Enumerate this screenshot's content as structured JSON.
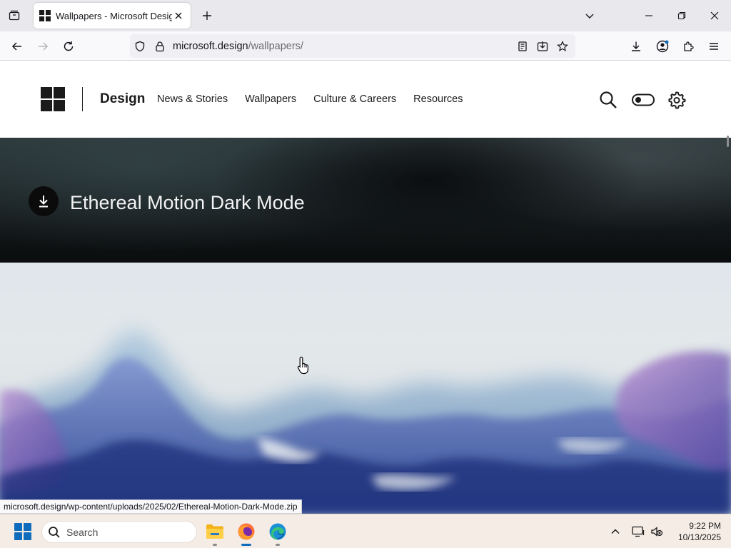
{
  "browser": {
    "tab": {
      "title": "Wallpapers - Microsoft Design"
    },
    "url": {
      "domain": "microsoft.design",
      "path": "/wallpapers/"
    }
  },
  "site": {
    "brand": "Design",
    "nav": [
      "News & Stories",
      "Wallpapers",
      "Culture & Careers",
      "Resources"
    ]
  },
  "hero": {
    "title": "Ethereal Motion Dark Mode"
  },
  "status_link": "microsoft.design/wp-content/uploads/2025/02/Ethereal-Motion-Dark-Mode.zip",
  "taskbar": {
    "search_label": "Search",
    "time": "9:22 PM",
    "date": "10/13/2025"
  },
  "colors": {
    "accent": "#0f6cbd",
    "taskbar_bg": "#f5ece6",
    "hero_dark": "#0a0c0d"
  },
  "icons": {
    "tab_list": "tab-list-icon",
    "new_tab": "plus-icon",
    "back": "arrow-left-icon",
    "forward": "arrow-right-icon",
    "reload": "reload-icon",
    "shield": "shield-icon",
    "lock": "lock-icon",
    "reader": "reader-view-icon",
    "pocket": "save-to-pocket-icon",
    "bookmark": "star-icon",
    "download": "download-icon",
    "account": "account-icon",
    "extensions": "puzzle-icon",
    "menu": "hamburger-icon",
    "search": "search-icon",
    "theme_toggle": "toggle-icon",
    "settings": "gear-icon"
  }
}
